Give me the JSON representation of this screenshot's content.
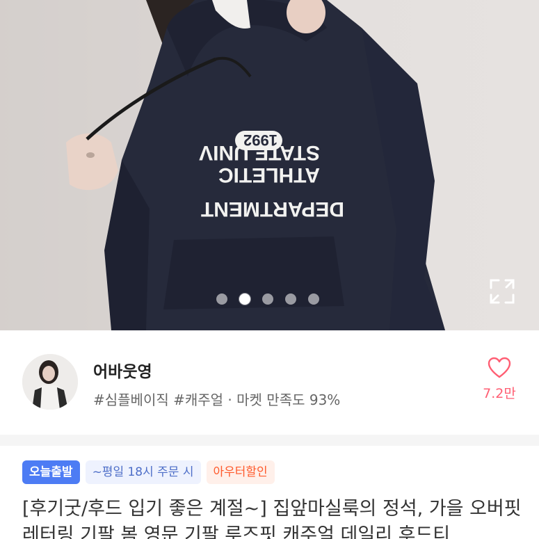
{
  "hero": {
    "print_lines": [
      "STATE UNIV",
      "1992",
      "ATHLETIC",
      "DEPARTMENT"
    ],
    "slide_count": 5,
    "active_slide": 2,
    "expand_icon": "expand-arrows-icon"
  },
  "shop": {
    "name": "어바웃영",
    "meta": "#심플베이직 #캐주얼 · 마켓 만족도 93%",
    "like_count": "7.2만",
    "like_icon": "heart-outline-icon",
    "like_color": "#ff5e73"
  },
  "product": {
    "badges": {
      "today": "오늘출발",
      "order": "~평일 18시 주문 시",
      "sale": "아우터할인"
    },
    "title": "[후기굿/후드 입기 좋은 계절~] 집앞마실룩의 정석, 가을 오버핏 레터링 기팔 봄 영문 기팔 루즈핏 캐주얼 데일리 후드티"
  },
  "colors": {
    "accent_blue": "#4d7cf4",
    "sale_orange": "#ff5a2c",
    "hoodie_navy": "#262a3b"
  }
}
